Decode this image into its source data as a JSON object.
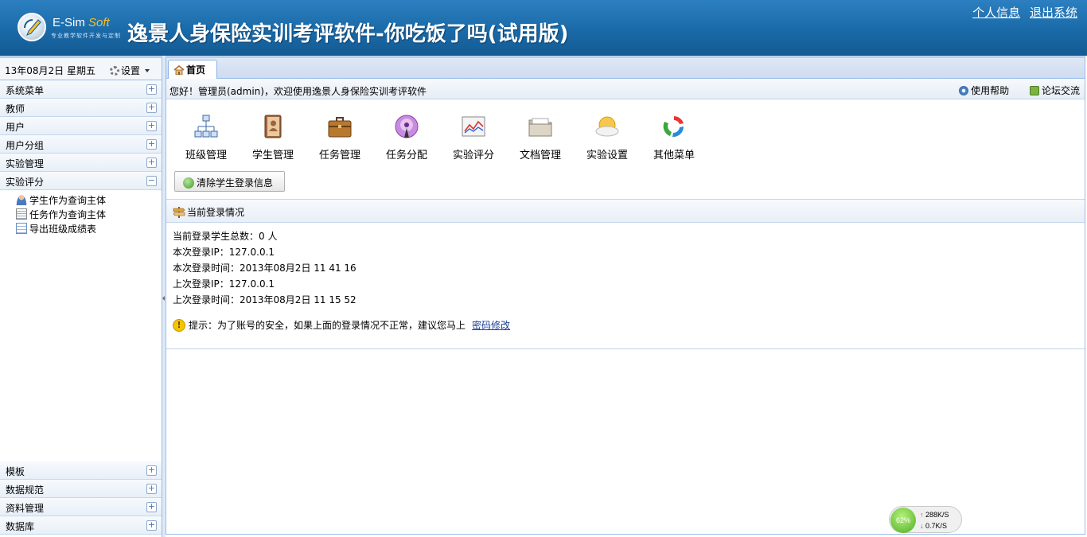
{
  "header": {
    "logo_brand": "E-Sim",
    "logo_brand_soft": "Soft",
    "logo_tagline": "专业教学软件开发与定制",
    "title": "逸景人身保险实训考评软件-你吃饭了吗(试用版)",
    "links": [
      "个人信息",
      "退出系统"
    ]
  },
  "left": {
    "date": "13年08月2日 星期五",
    "settings_label": "设置",
    "menus_top": [
      {
        "label": "系统菜单",
        "toggle": "+"
      },
      {
        "label": "教师",
        "toggle": "+"
      },
      {
        "label": "用户",
        "toggle": "+"
      },
      {
        "label": "用户分组",
        "toggle": "+"
      },
      {
        "label": "实验管理",
        "toggle": "+"
      },
      {
        "label": "实验评分",
        "toggle": "−"
      }
    ],
    "sub_items": [
      "学生作为查询主体",
      "任务作为查询主体",
      "导出班级成绩表"
    ],
    "menus_bottom": [
      {
        "label": "模板",
        "toggle": "+"
      },
      {
        "label": "数据规范",
        "toggle": "+"
      },
      {
        "label": "资料管理",
        "toggle": "+"
      },
      {
        "label": "数据库",
        "toggle": "+"
      }
    ]
  },
  "main": {
    "tab_label": "首页",
    "welcome": "您好！管理员(admin)，欢迎使用逸景人身保险实训考评软件",
    "help_label": "使用帮助",
    "forum_label": "论坛交流",
    "tools": [
      "班级管理",
      "学生管理",
      "任务管理",
      "任务分配",
      "实验评分",
      "文档管理",
      "实验设置",
      "其他菜单"
    ],
    "clear_button": "清除学生登录信息",
    "section_title": "当前登录情况",
    "info_lines": [
      "当前登录学生总数：0 人",
      "本次登录IP：127.0.0.1",
      "本次登录时间：2013年08月2日  11 41 16",
      "上次登录IP：127.0.0.1",
      "上次登录时间：2013年08月2日  11 15 52"
    ],
    "tip_text": "提示：为了账号的安全，如果上面的登录情况不正常，建议您马上",
    "tip_link": "密码修改"
  },
  "net_widget": {
    "percent": "62%",
    "up": "288K/S",
    "down": "0.7K/S"
  }
}
